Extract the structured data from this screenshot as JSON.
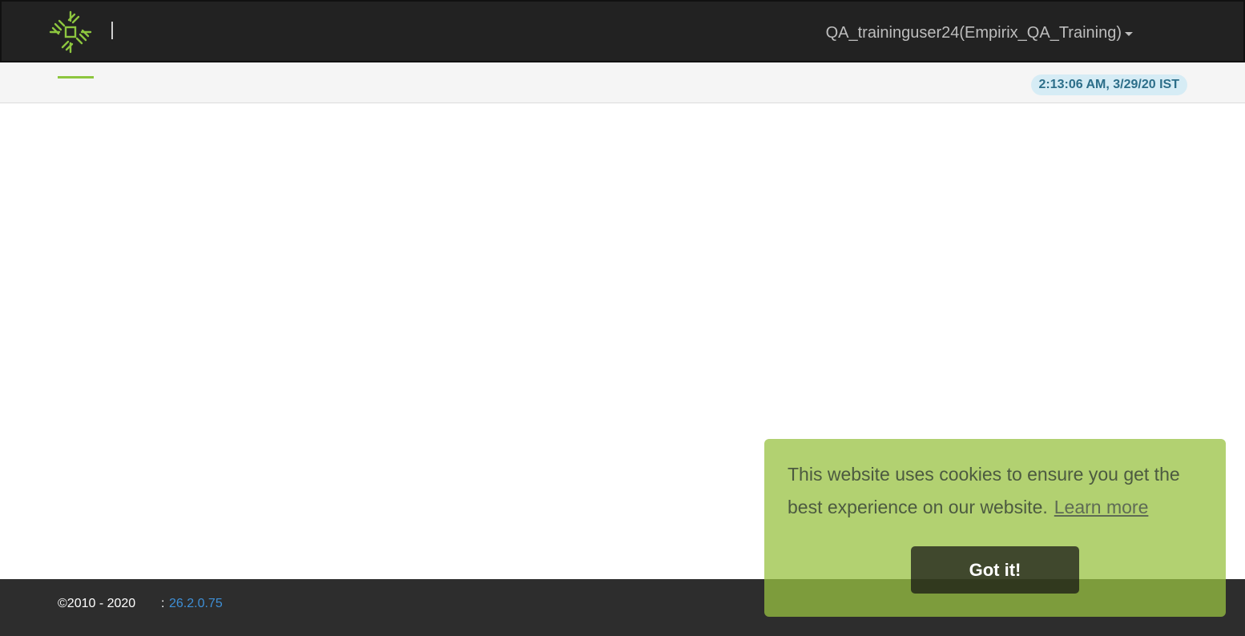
{
  "header": {
    "logo_icon": "empirix-logo-icon",
    "user_label": "QA_traininguser24(Empirix_QA_Training)",
    "user_menu_icon": "caret-down-icon"
  },
  "subheader": {
    "clock": "2:13:06 AM, 3/29/20 IST"
  },
  "footer": {
    "copyright": "©2010 - 2020",
    "separator": ":",
    "version": "26.2.0.75"
  },
  "cookie_banner": {
    "message": "This website uses cookies to ensure you get the best experience on our website.",
    "learn_more": "Learn more",
    "accept_label": "Got it!"
  },
  "colors": {
    "accent": "#8dc63f",
    "header_bg": "#222222",
    "footer_bg": "#2d2d2d",
    "clock_bg": "#d6ecf5",
    "clock_text": "#2c6e89",
    "version_link": "#3e8fd6",
    "cookie_bg": "#b3d072"
  }
}
